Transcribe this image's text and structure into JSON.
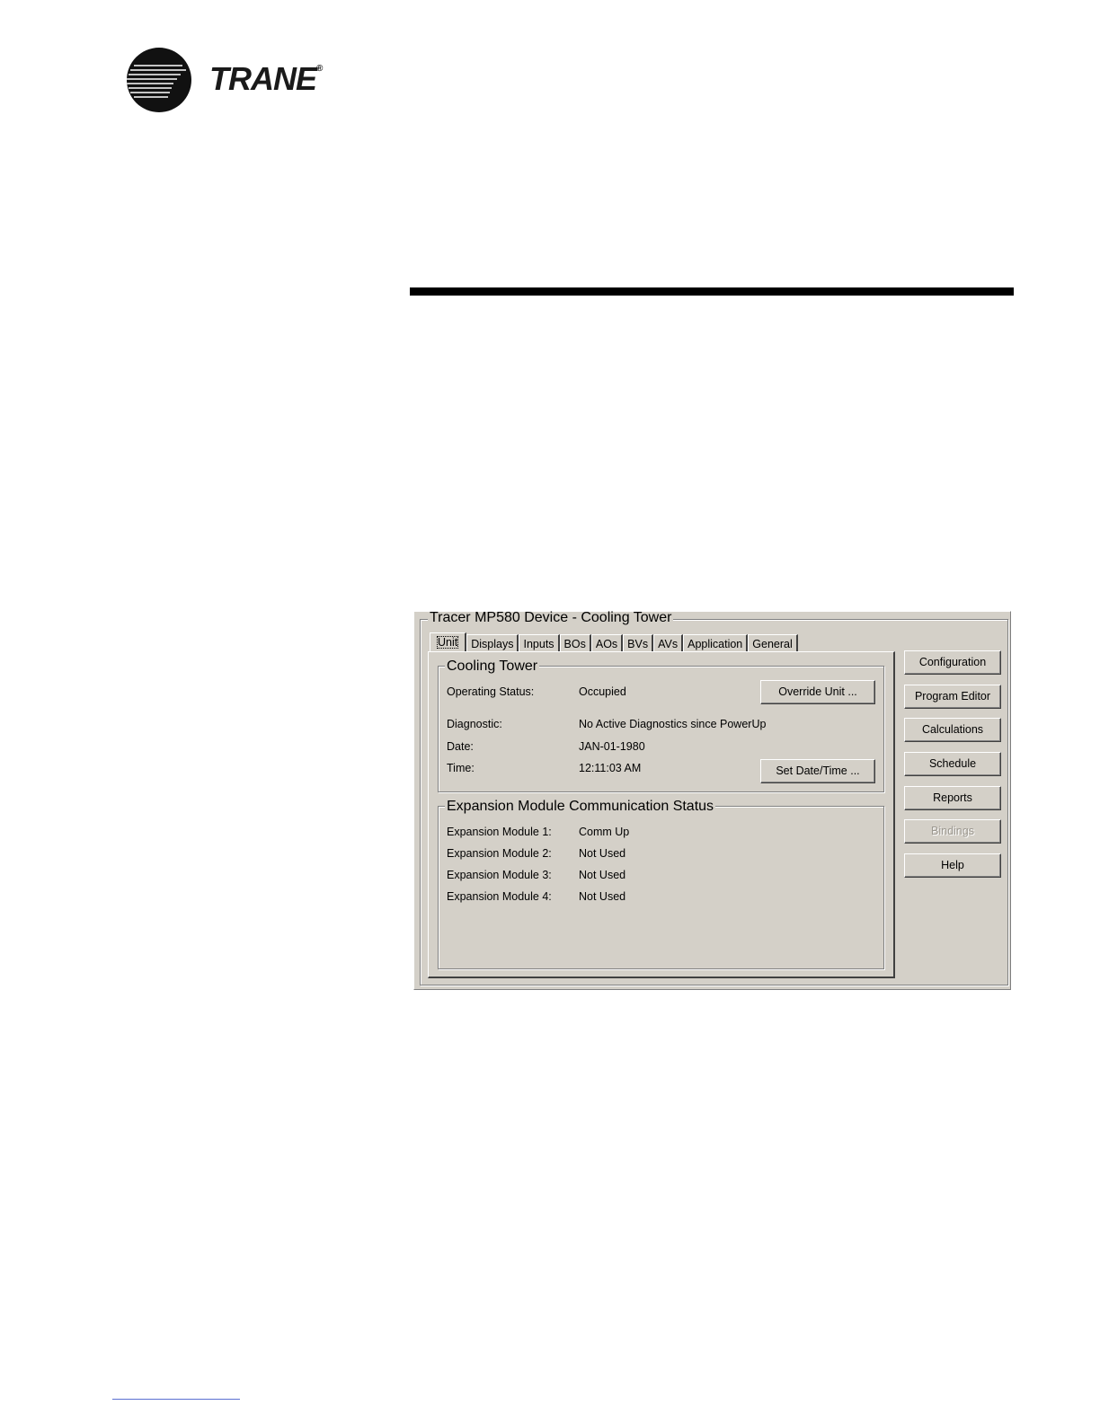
{
  "logo": {
    "brand": "TRANE",
    "registered": "®"
  },
  "dialog": {
    "title": "Tracer MP580 Device - Cooling Tower",
    "tabs": [
      {
        "label": "Unit",
        "active": true
      },
      {
        "label": "Displays"
      },
      {
        "label": "Inputs"
      },
      {
        "label": "BOs"
      },
      {
        "label": "AOs"
      },
      {
        "label": "BVs"
      },
      {
        "label": "AVs"
      },
      {
        "label": "Application"
      },
      {
        "label": "General"
      }
    ],
    "cooling_tower": {
      "legend": "Cooling Tower",
      "operating_status_label": "Operating Status:",
      "operating_status_value": "Occupied",
      "override_button": "Override Unit ...",
      "diagnostic_label": "Diagnostic:",
      "diagnostic_value": "No Active Diagnostics since PowerUp",
      "date_label": "Date:",
      "date_value": "JAN-01-1980",
      "time_label": "Time:",
      "time_value": "12:11:03 AM",
      "set_date_time_button": "Set Date/Time ..."
    },
    "expansion": {
      "legend": "Expansion Module Communication Status",
      "modules": [
        {
          "label": "Expansion Module 1:",
          "value": "Comm Up"
        },
        {
          "label": "Expansion Module 2:",
          "value": "Not Used"
        },
        {
          "label": "Expansion Module 3:",
          "value": "Not Used"
        },
        {
          "label": "Expansion Module 4:",
          "value": "Not Used"
        }
      ]
    },
    "side_buttons": {
      "configuration": "Configuration",
      "program_editor": "Program Editor",
      "calculations": "Calculations",
      "schedule": "Schedule",
      "reports": "Reports",
      "bindings": "Bindings",
      "help": "Help"
    }
  },
  "colors": {
    "dialog_bg": "#d4d0c8",
    "rule": "#000000",
    "disabled_text": "#9a968e"
  }
}
